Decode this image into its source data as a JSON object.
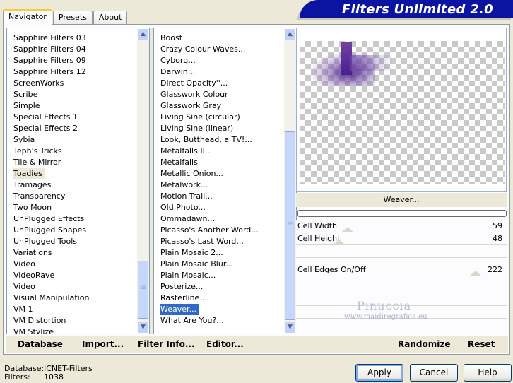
{
  "header": {
    "title": "Filters Unlimited 2.0"
  },
  "tabs": [
    {
      "label": "Navigator",
      "active": true
    },
    {
      "label": "Presets",
      "active": false
    },
    {
      "label": "About",
      "active": false
    }
  ],
  "categories": {
    "items": [
      "Sapphire Filters 03",
      "Sapphire Filters 04",
      "Sapphire Filters 09",
      "Sapphire Filters 12",
      "ScreenWorks",
      "Scribe",
      "Simple",
      "Special Effects 1",
      "Special Effects 2",
      "Sybia",
      "Teph's Tricks",
      "Tile & Mirror",
      "Toadies",
      "Tramages",
      "Transparency",
      "Two Moon",
      "UnPlugged Effects",
      "UnPlugged Shapes",
      "UnPlugged Tools",
      "Variations",
      "Video",
      "VideoRave",
      "Video",
      "Visual Manipulation",
      "VM 1",
      "VM Distortion",
      "VM Stylize"
    ],
    "selected": "Toadies"
  },
  "filters": {
    "items": [
      "Boost",
      "Crazy Colour Waves...",
      "Cyborg...",
      "Darwin...",
      "Direct Opacity''...",
      "Glasswork Colour",
      "Glasswork Gray",
      "Living Sine (circular)",
      "Living Sine (linear)",
      "Look, Butthead, a TV!...",
      "Metalfalls II...",
      "Metalfalls",
      "Metallic Onion...",
      "Metalwork...",
      "Motion Trail...",
      "Old Photo...",
      "Ommadawn...",
      "Picasso's Another Word...",
      "Picasso's Last Word...",
      "Plain Mosaic 2...",
      "Plain Mosaic Blur...",
      "Plain Mosaic...",
      "Posterize...",
      "Rasterline...",
      "Weaver...",
      "What Are You?..."
    ],
    "selected": "Weaver..."
  },
  "preview": {
    "filter_name": "Weaver...",
    "progress": 0
  },
  "parameters": [
    {
      "label": "Cell Width",
      "value": "59",
      "level": 59
    },
    {
      "label": "Cell Height",
      "value": "48",
      "level": 48
    },
    {
      "label": "",
      "value": "",
      "level": null
    },
    {
      "label": "Cell Edges On/Off",
      "value": "222",
      "level": 222
    },
    {
      "label": "",
      "value": "",
      "level": null
    },
    {
      "label": "",
      "value": "",
      "level": null
    },
    {
      "label": "",
      "value": "",
      "level": null
    },
    {
      "label": "",
      "value": "",
      "level": null
    }
  ],
  "watermark": {
    "line1": "Pinuccia",
    "line2": "www.maidiregrafica.eu"
  },
  "toolbar": {
    "database": "Database",
    "import": "Import...",
    "filter_info": "Filter Info...",
    "editor": "Editor...",
    "randomize": "Randomize",
    "reset": "Reset"
  },
  "status": {
    "database_label": "Database:",
    "database_value": "ICNET-Filters",
    "filters_label": "Filters:",
    "filters_value": "1038"
  },
  "buttons": {
    "apply": "Apply",
    "cancel": "Cancel",
    "help": "Help"
  },
  "colors": {
    "banner": "#0a14a0",
    "selection": "#316ac5",
    "face": "#ece9d8"
  },
  "icons": {
    "scroll_up": "▲",
    "scroll_down": "▼"
  }
}
